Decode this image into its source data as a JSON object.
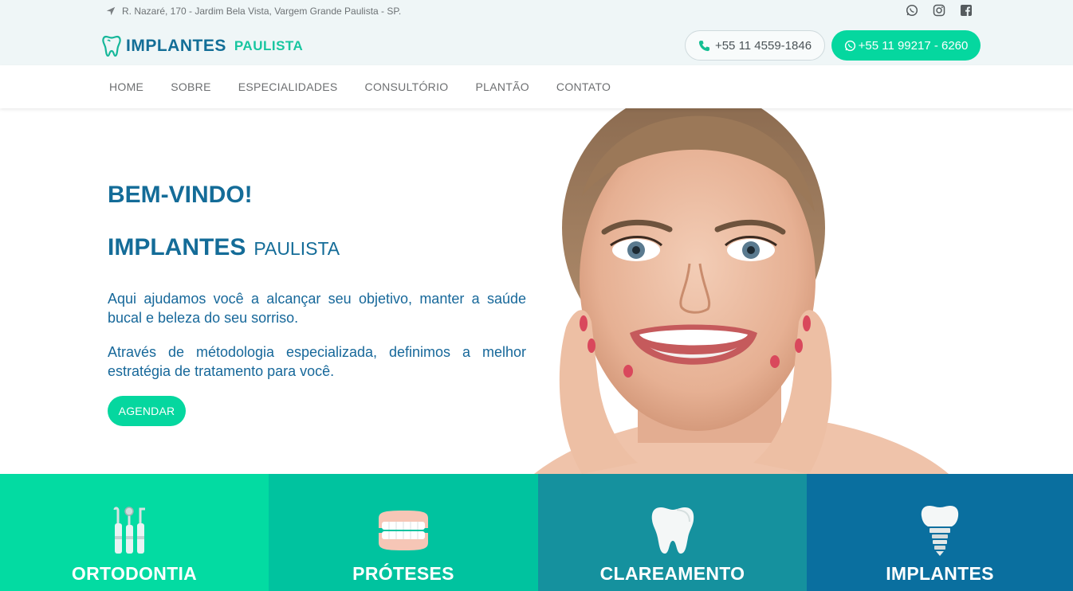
{
  "topbar": {
    "address": "R. Nazaré, 170 - Jardim Bela Vista, Vargem Grande Paulista - SP.",
    "address_icon": "location-arrow-icon",
    "socials": [
      "whatsapp-icon",
      "instagram-icon",
      "facebook-icon"
    ]
  },
  "logo": {
    "main": "IMPLANTES",
    "sub": "PAULISTA",
    "icon": "tooth-logo-icon"
  },
  "contact": {
    "phone": "+55 11 4559-1846",
    "whatsapp": "+55 11 99217 - 6260"
  },
  "nav": {
    "items": [
      "HOME",
      "SOBRE",
      "ESPECIALIDADES",
      "CONSULTÓRIO",
      "PLANTÃO",
      "CONTATO"
    ]
  },
  "hero": {
    "welcome": "BEM-VINDO!",
    "brand_main": "IMPLANTES",
    "brand_sub": "PAULISTA",
    "paragraph1": "Aqui ajudamos você a alcançar seu objetivo, manter a saúde bucal e beleza do seu sorriso.",
    "paragraph2": "Através de métodologia especializada, definimos a melhor estratégia de tratamento para você.",
    "cta": "AGENDAR"
  },
  "services": [
    {
      "title": "ORTODONTIA",
      "icon": "dental-tools-icon"
    },
    {
      "title": "PRÓTESES",
      "icon": "denture-icon"
    },
    {
      "title": "CLAREAMENTO",
      "icon": "tooth-icon"
    },
    {
      "title": "IMPLANTES",
      "icon": "tooth-implant-icon"
    }
  ],
  "colors": {
    "primary_blue": "#146c98",
    "accent_green": "#05d79f",
    "service_1": "#03dba2",
    "service_2": "#00c39f",
    "service_3": "#15919e",
    "service_4": "#0a6f9f"
  }
}
